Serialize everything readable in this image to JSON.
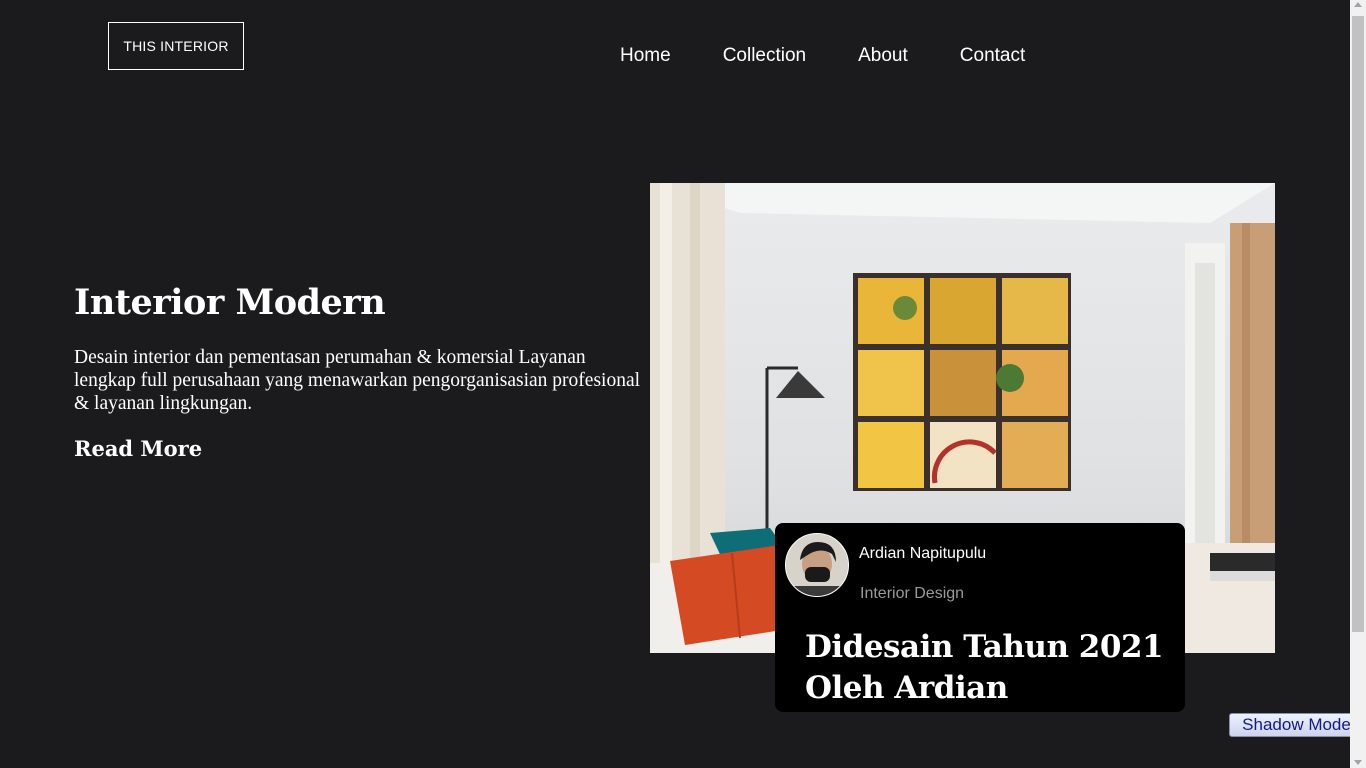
{
  "header": {
    "logo": "THIS INTERIOR",
    "nav": [
      "Home",
      "Collection",
      "About",
      "Contact"
    ]
  },
  "hero": {
    "title": "Interior Modern",
    "description": "Desain interior dan pementasan perumahan & komersial Layanan lengkap full perusahaan yang menawarkan pengorganisasian profesional & layanan lingkungan.",
    "read_more": "Read More"
  },
  "card": {
    "author": "Ardian Napitupulu",
    "role": "Interior Design",
    "title": "Didesain Tahun 2021 Oleh Ardian"
  },
  "shadow_mode_label": "Shadow Mode",
  "colors": {
    "background": "#1b1b1d",
    "card": "#000000",
    "accent_yellow": "#e9b63a",
    "pillow_orange": "#d44a22",
    "pillow_teal": "#0f6d78"
  }
}
